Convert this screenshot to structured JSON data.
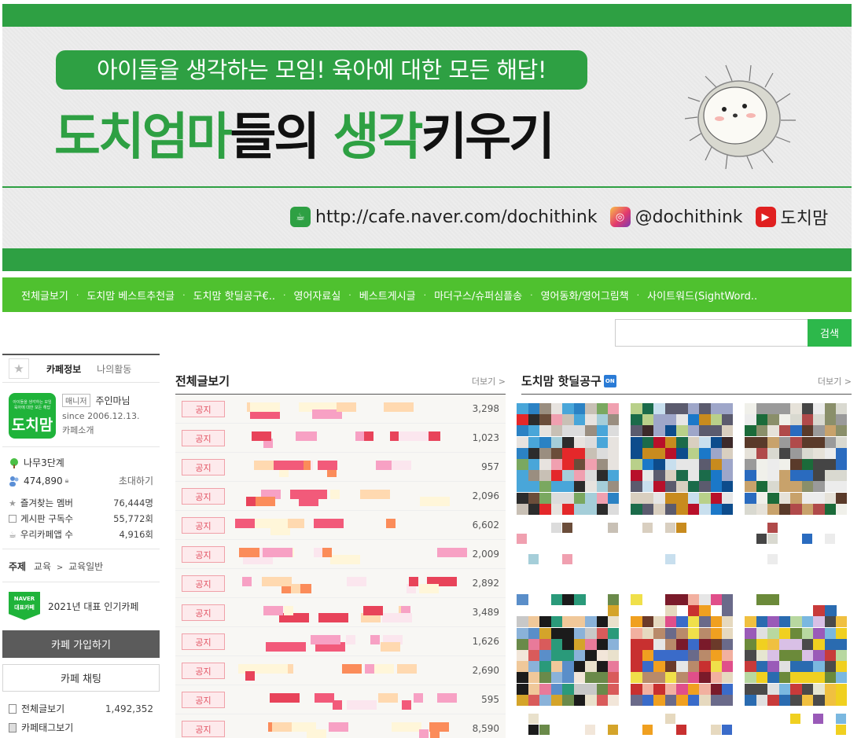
{
  "banner": {
    "slogan": "아이들을 생각하는 모임! 육아에 대한 모든 해답!",
    "headline_green1": "도치엄마",
    "headline_dark1": "들의",
    "headline_green2": "생각",
    "headline_dark2": "키우기",
    "url": "http://cafe.naver.com/dochithink",
    "instagram": "@dochithink",
    "youtube": "도치맘",
    "colors": {
      "green": "#2ea043",
      "menu_green": "#4fc12f"
    }
  },
  "menu": {
    "items": [
      "전체글보기",
      "도치맘 베스트추천글",
      "도치맘 핫딜공구€..",
      "영어자료실",
      "베스트게시글",
      "마더구스/슈퍼심플송",
      "영어동화/영어그림책",
      "사이트워드(SightWord.."
    ],
    "separator": "·"
  },
  "search": {
    "placeholder": "",
    "button": "검색"
  },
  "sidebar": {
    "tabs": {
      "cafe_info": "카페정보",
      "my_activity": "나의활동"
    },
    "manager_badge": "매니저",
    "manager_name": "주인마님",
    "since": "since 2006.12.13.",
    "intro": "카페소개",
    "logo_text": "도치맘",
    "logo_small": "아이들을 생각하는 모임 육아에 대한 모든 해답",
    "level": "나무3단계",
    "members": "474,890",
    "invite": "초대하기",
    "stats": [
      {
        "label": "즐겨찾는 멤버",
        "value": "76,444명",
        "icon": "star-icon"
      },
      {
        "label": "게시판 구독수",
        "value": "55,772회",
        "icon": "subscribe-icon"
      },
      {
        "label": "우리카페앱 수",
        "value": "4,916회",
        "icon": "app-icon"
      }
    ],
    "subject_label": "주제",
    "subject_1": "교육",
    "subject_arrow": ">",
    "subject_2": "교육일반",
    "award_badge_1": "NAVER",
    "award_badge_2": "대표카페",
    "award": "2021년 대표 인기카페",
    "join": "카페 가입하기",
    "chat": "카페 채팅",
    "all_posts": "전체글보기",
    "all_posts_count": "1,492,352",
    "tags": "카페태그보기"
  },
  "board": {
    "title": "전체글보기",
    "more": "더보기 >",
    "notice_label": "공지",
    "counts": [
      "3,298",
      "1,023",
      "957",
      "2,096",
      "6,602",
      "2,009",
      "2,892",
      "3,489",
      "1,626",
      "2,690",
      "595",
      "8,590"
    ]
  },
  "gallery": {
    "title": "도치맘 핫딜공구",
    "badge": "ON",
    "more": "더보기 >"
  }
}
